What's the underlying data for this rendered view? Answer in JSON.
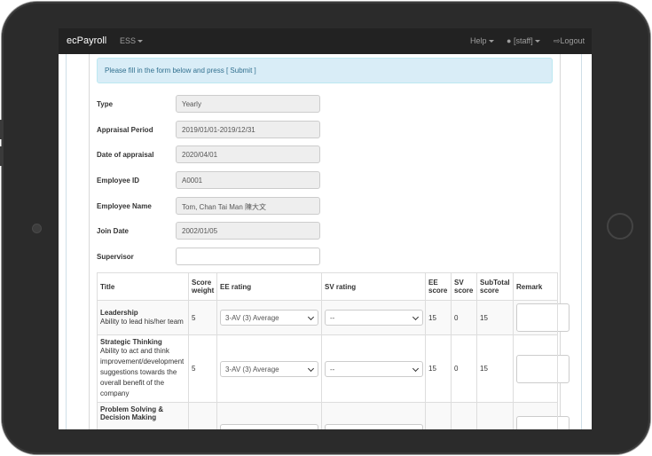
{
  "navbar": {
    "brand": "ecPayroll",
    "ess": "ESS",
    "help": "Help",
    "user": "[staff]",
    "logout": "Logout"
  },
  "alert": {
    "message": "Please fill in the form below and press [ Submit ]"
  },
  "form": {
    "type": {
      "label": "Type",
      "value": "Yearly"
    },
    "appraisal_period": {
      "label": "Appraisal Period",
      "value": "2019/01/01-2019/12/31"
    },
    "date_of_appraisal": {
      "label": "Date of appraisal",
      "value": "2020/04/01"
    },
    "employee_id": {
      "label": "Employee ID",
      "value": "A0001"
    },
    "employee_name": {
      "label": "Employee Name",
      "value": "Tom, Chan Tai Man 陳大文"
    },
    "join_date": {
      "label": "Join Date",
      "value": "2002/01/05"
    },
    "supervisor": {
      "label": "Supervisor",
      "value": ""
    }
  },
  "table": {
    "headers": {
      "title": "Title",
      "score_weight": "Score weight",
      "ee_rating": "EE rating",
      "sv_rating": "SV rating",
      "ee_score": "EE score",
      "sv_score": "SV score",
      "subtotal_score": "SubTotal score",
      "remark": "Remark"
    },
    "rows": [
      {
        "title": "Leadership",
        "desc": "Ability to lead his/her team",
        "weight": "5",
        "ee_rating": "3-AV (3) Average",
        "sv_rating": "--",
        "ee_score": "15",
        "sv_score": "0",
        "subtotal": "15"
      },
      {
        "title": "Strategic Thinking",
        "desc": "Ability to act and think improvement/development suggestions towards the overall benefit of the company",
        "weight": "5",
        "ee_rating": "3-AV (3) Average",
        "sv_rating": "--",
        "ee_score": "15",
        "sv_score": "0",
        "subtotal": "15"
      },
      {
        "title": "Problem Solving & Decision Making",
        "desc": "",
        "weight": "",
        "ee_rating": "",
        "sv_rating": "",
        "ee_score": "",
        "sv_score": "",
        "subtotal": ""
      }
    ]
  }
}
